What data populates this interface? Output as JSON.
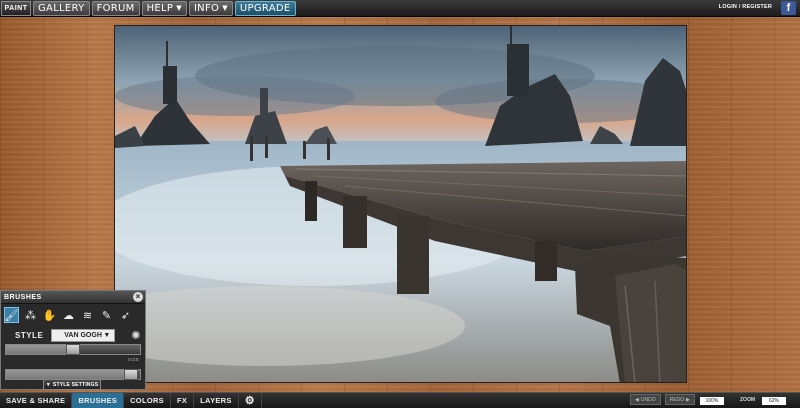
{
  "app": {
    "logo_text": "PAINT"
  },
  "nav": {
    "items": [
      {
        "label": "GALLERY",
        "has_caret": false
      },
      {
        "label": "FORUM",
        "has_caret": false
      },
      {
        "label": "HELP",
        "has_caret": true
      },
      {
        "label": "INFO",
        "has_caret": true
      },
      {
        "label": "UPGRADE",
        "has_caret": false
      }
    ],
    "login_label": "LOGIN / REGISTER",
    "facebook_icon": "f"
  },
  "brushes_panel": {
    "title": "BRUSHES",
    "close_icon": "×",
    "tools": [
      "brush-icon",
      "sponge-icon",
      "hand-icon",
      "blob-icon",
      "smudge-icon",
      "pen-icon",
      "feather-icon"
    ],
    "style_label": "STYLE",
    "style_value": "VAN GOGH",
    "size_label": "SIZE",
    "opacity_label": "OPACITY",
    "size_level": 0.5,
    "opacity_level": 0.98,
    "style_settings_label": "STYLE SETTINGS"
  },
  "bottom_bar": {
    "items": [
      {
        "label": "SAVE & SHARE",
        "active": false
      },
      {
        "label": "BRUSHES",
        "active": true
      },
      {
        "label": "COLORS",
        "active": false
      },
      {
        "label": "FX",
        "active": false
      },
      {
        "label": "LAYERS",
        "active": false
      }
    ],
    "undo_label": "UNDO",
    "redo_label": "REDO",
    "brush_zoom_value": "100%",
    "zoom_label": "ZOOM",
    "zoom_value": "62%"
  },
  "colors": {
    "accent": "#2a6f95",
    "facebook": "#3b5998"
  }
}
